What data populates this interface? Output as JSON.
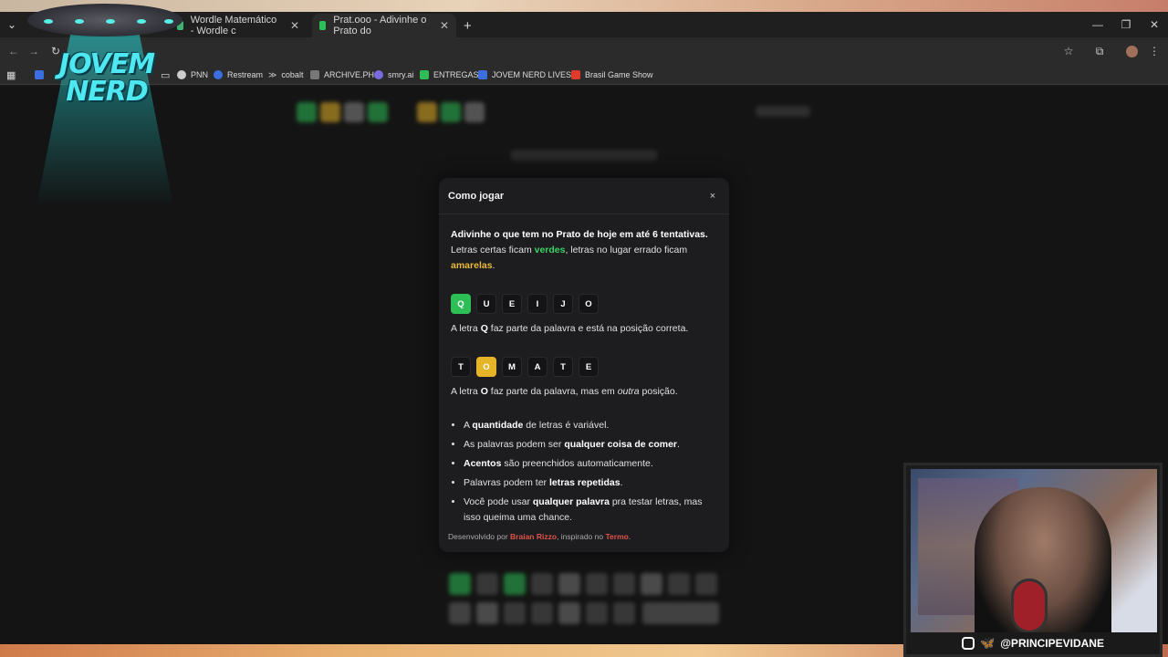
{
  "browser": {
    "tabs": [
      {
        "title": "Wordle Matemático - Wordle c",
        "favicon_color": "#3cb371"
      },
      {
        "title": "Prat.ooo - Adivinhe o Prato do",
        "favicon_color": "#2dbf56",
        "active": true
      }
    ],
    "new_tab_label": "+",
    "bookmarks": [
      {
        "label": "PNN",
        "icon_color": "#cccccc"
      },
      {
        "label": "Restream",
        "icon_color": "#3b6fe0"
      },
      {
        "label": "cobalt",
        "icon_color": "#cccccc"
      },
      {
        "label": "ARCHIVE.PH",
        "icon_color": "#777777"
      },
      {
        "label": "smry.ai",
        "icon_color": "#7a6ae0"
      },
      {
        "label": "ENTREGAS",
        "icon_color": "#2dbf56"
      },
      {
        "label": "JOVEM NERD LIVES...",
        "icon_color": "#3b6fe0"
      },
      {
        "label": "Brasil Game Show",
        "icon_color": "#e03a2a"
      }
    ]
  },
  "modal": {
    "title": "Como jogar",
    "close_label": "×",
    "intro_bold": "Adivinhe o que tem no Prato de hoje em até 6 tentativas.",
    "intro_a": "Letras certas ficam ",
    "intro_green": "verdes",
    "intro_b": ", letras no lugar errado ficam ",
    "intro_yellow": "amarelas",
    "intro_c": ".",
    "example1": {
      "letters": [
        "Q",
        "U",
        "E",
        "I",
        "J",
        "O"
      ],
      "text_a": "A letra ",
      "text_letter": "Q",
      "text_b": " faz parte da palavra e está na posição correta."
    },
    "example2": {
      "letters": [
        "T",
        "O",
        "M",
        "A",
        "T",
        "E"
      ],
      "text_a": "A letra ",
      "text_letter": "O",
      "text_b": " faz parte da palavra, mas em ",
      "text_italic": "outra",
      "text_c": " posição."
    },
    "rules": [
      {
        "a": "A ",
        "b": "quantidade",
        "c": " de letras é variável."
      },
      {
        "a": "As palavras podem ser ",
        "b": "qualquer coisa de comer",
        "c": "."
      },
      {
        "a": "",
        "b": "Acentos",
        "c": " são preenchidos automaticamente."
      },
      {
        "a": "Palavras podem ter ",
        "b": "letras repetidas",
        "c": "."
      },
      {
        "a": "Você pode usar ",
        "b": "qualquer palavra",
        "c": " pra testar letras, mas isso queima uma chance."
      }
    ],
    "footer_a": "Desenvolvido por ",
    "footer_author": "Braian Rizzo",
    "footer_b": ", inspirado no ",
    "footer_inspired": "Termo",
    "footer_c": "."
  },
  "overlay": {
    "logo_text": "JOVEM NERD",
    "handle": "@PRINCIPEVIDANE"
  }
}
